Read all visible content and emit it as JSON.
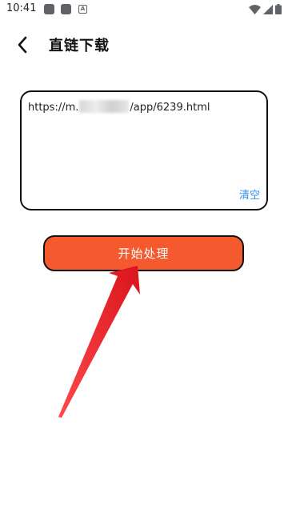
{
  "status_bar": {
    "time": "10:41",
    "icons": [
      "gallery-icon",
      "app-icon",
      "a-badge-icon"
    ],
    "system_icons": [
      "wifi-icon",
      "signal-icon",
      "battery-icon"
    ]
  },
  "header": {
    "back_icon": "chevron-left-icon",
    "title": "直链下载"
  },
  "url_box": {
    "url_prefix": "https://m.",
    "url_suffix": "/app/6239.html",
    "clear_label": "清空",
    "clear_color": "#2f8ee8"
  },
  "start_button": {
    "label": "开始处理",
    "color": "#f45a2d"
  },
  "annotation": {
    "arrow_color": "#e8232b"
  }
}
